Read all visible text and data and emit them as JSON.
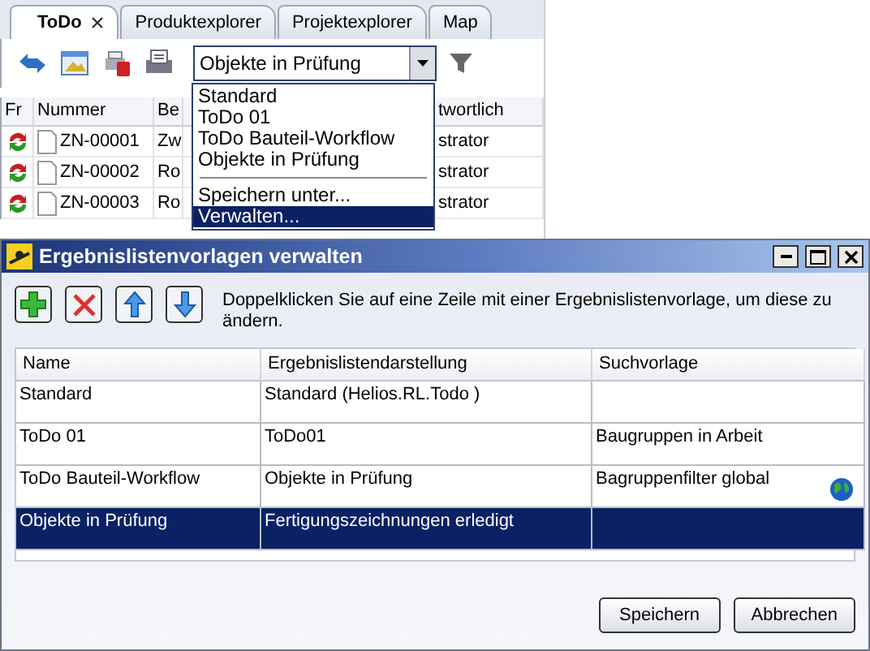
{
  "app": {
    "tabs": [
      {
        "label": "ToDo",
        "selected": true,
        "closable": true
      },
      {
        "label": "Produktexplorer",
        "selected": false,
        "closable": false
      },
      {
        "label": "Projektexplorer",
        "selected": false,
        "closable": false
      },
      {
        "label": "Map",
        "selected": false,
        "closable": false
      }
    ],
    "combo_value": "Objekte in Prüfung",
    "dropdown": {
      "templates": [
        {
          "label": "Standard",
          "selected": false
        },
        {
          "label": "ToDo 01",
          "selected": false
        },
        {
          "label": "ToDo Bauteil-Workflow",
          "selected": false
        },
        {
          "label": "Objekte in Prüfung",
          "selected": false
        }
      ],
      "actions": [
        {
          "label": "Speichern unter...",
          "selected": false
        },
        {
          "label": "Verwalten...",
          "selected": true
        }
      ]
    },
    "table": {
      "columns": [
        "Fr",
        "Nummer",
        "Be",
        "twortlich"
      ],
      "rows": [
        {
          "number": "ZN-00001",
          "column_3": "Zw",
          "column_4": "strator"
        },
        {
          "number": "ZN-00002",
          "column_3": "Ro",
          "column_4": "strator"
        },
        {
          "number": "ZN-00003",
          "column_3": "Ro",
          "column_4": "strator"
        }
      ]
    }
  },
  "dialog": {
    "title": "Ergebnislistenvorlagen verwalten",
    "hint": "Doppelklicken Sie auf eine Zeile mit einer Ergebnislistenvorlage, um diese zu ändern.",
    "columns": [
      "Name",
      "Ergebnislistendarstellung",
      "Suchvorlage"
    ],
    "rows": [
      {
        "name": "Standard",
        "display": "Standard (Helios.RL.Todo )",
        "search": "",
        "global": false,
        "selected": false
      },
      {
        "name": "ToDo 01",
        "display": "ToDo01",
        "search": "Baugruppen in Arbeit",
        "global": false,
        "selected": false
      },
      {
        "name": "ToDo Bauteil-Workflow",
        "display": "Objekte in Prüfung",
        "search": "Bagruppenfilter global",
        "global": true,
        "selected": false
      },
      {
        "name": "Objekte in Prüfung",
        "display": "Fertigungszeichnungen erledigt",
        "search": "",
        "global": false,
        "selected": true
      }
    ],
    "buttons": [
      "Speichern",
      "Abbrechen"
    ]
  }
}
